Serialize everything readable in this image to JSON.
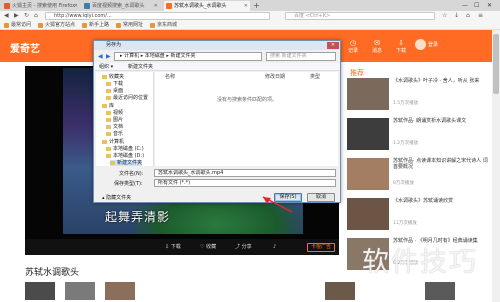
{
  "browser": {
    "tabs": [
      {
        "label": "火狐主页 - 搜索使用 Firefox",
        "active": false,
        "favicon_color": "#e35d2a"
      },
      {
        "label": "百度视频搜索_水调歌头",
        "active": false,
        "favicon_color": "#3c7fb1"
      },
      {
        "label": "苏轼水调歌头_水调歌头",
        "active": true,
        "favicon_color": "#ff6b22"
      }
    ],
    "new_tab": "+",
    "window_controls": [
      "—",
      "☐",
      "✕"
    ],
    "url": "http://www.iqiyi.com/...",
    "search_placeholder": "百度 <Ctrl+K>",
    "bookmarks": [
      "最常访问",
      "火狐官方站点",
      "新手上路",
      "常用网址",
      "京东商城"
    ]
  },
  "site": {
    "logo": "爱奇艺",
    "header_icons": [
      {
        "icon": "upload-icon",
        "label": "上传"
      },
      {
        "icon": "history-icon",
        "label": "记录"
      },
      {
        "icon": "message-icon",
        "label": "消息"
      },
      {
        "icon": "download-icon",
        "label": "下载"
      }
    ],
    "user_name": "登录"
  },
  "player": {
    "subtitle": "起舞弄清影",
    "controls": [
      "下载",
      "收藏",
      "分享"
    ],
    "hire_ad": "卡棍广告"
  },
  "video_title": "苏轼水调歌头",
  "sidebar": {
    "title": "推荐",
    "items": [
      {
        "title": "《水调歌头》叶子冷 · 舍人，听从 张来",
        "meta": "1.5万次播放"
      },
      {
        "title": "苏轼作品· 朗诵赏析水调歌头课文",
        "meta": "1.2万次播放"
      },
      {
        "title": "苏轼作品· 点读课本知识讲解之宋代诗人 词首要概况",
        "meta": "8万次播放"
      },
      {
        "title": "《水调歌头》苏轼诵读欣赏",
        "meta": "11万次播放"
      },
      {
        "title": "苏轼作品 · 《明月几时有》经典诵读集",
        "meta": "6.2万次播放"
      }
    ]
  },
  "dialog": {
    "title": "另存为",
    "address": "▸ 计算机 ▸ 本地磁盘 ▸ 新建文件夹",
    "search_placeholder": "搜索 新建文件夹",
    "toolbar": [
      "组织 ▾",
      "新建文件夹"
    ],
    "tree_items": [
      "收藏夹",
      "下载",
      "桌面",
      "最近访问的位置",
      "库",
      "视频",
      "图片",
      "文档",
      "音乐",
      "计算机",
      "本地磁盘 (C:)",
      "本地磁盘 (D:)",
      "新建文件夹"
    ],
    "columns": [
      "名称",
      "修改日期",
      "类型"
    ],
    "empty_message": "没有与搜索条件匹配的项。",
    "filename_label": "文件名(N):",
    "filename_value": "苏轼水调歌头_水调歌头.mp4",
    "filetype_label": "保存类型(T):",
    "filetype_value": "所有文件 (*.*)",
    "hide_folders": "▴ 隐藏文件夹",
    "save_label": "保存(S)",
    "cancel_label": "取消"
  },
  "watermark": "软件技巧",
  "colors": {
    "brand": "#ff6b22",
    "arrow": "#e02828"
  }
}
